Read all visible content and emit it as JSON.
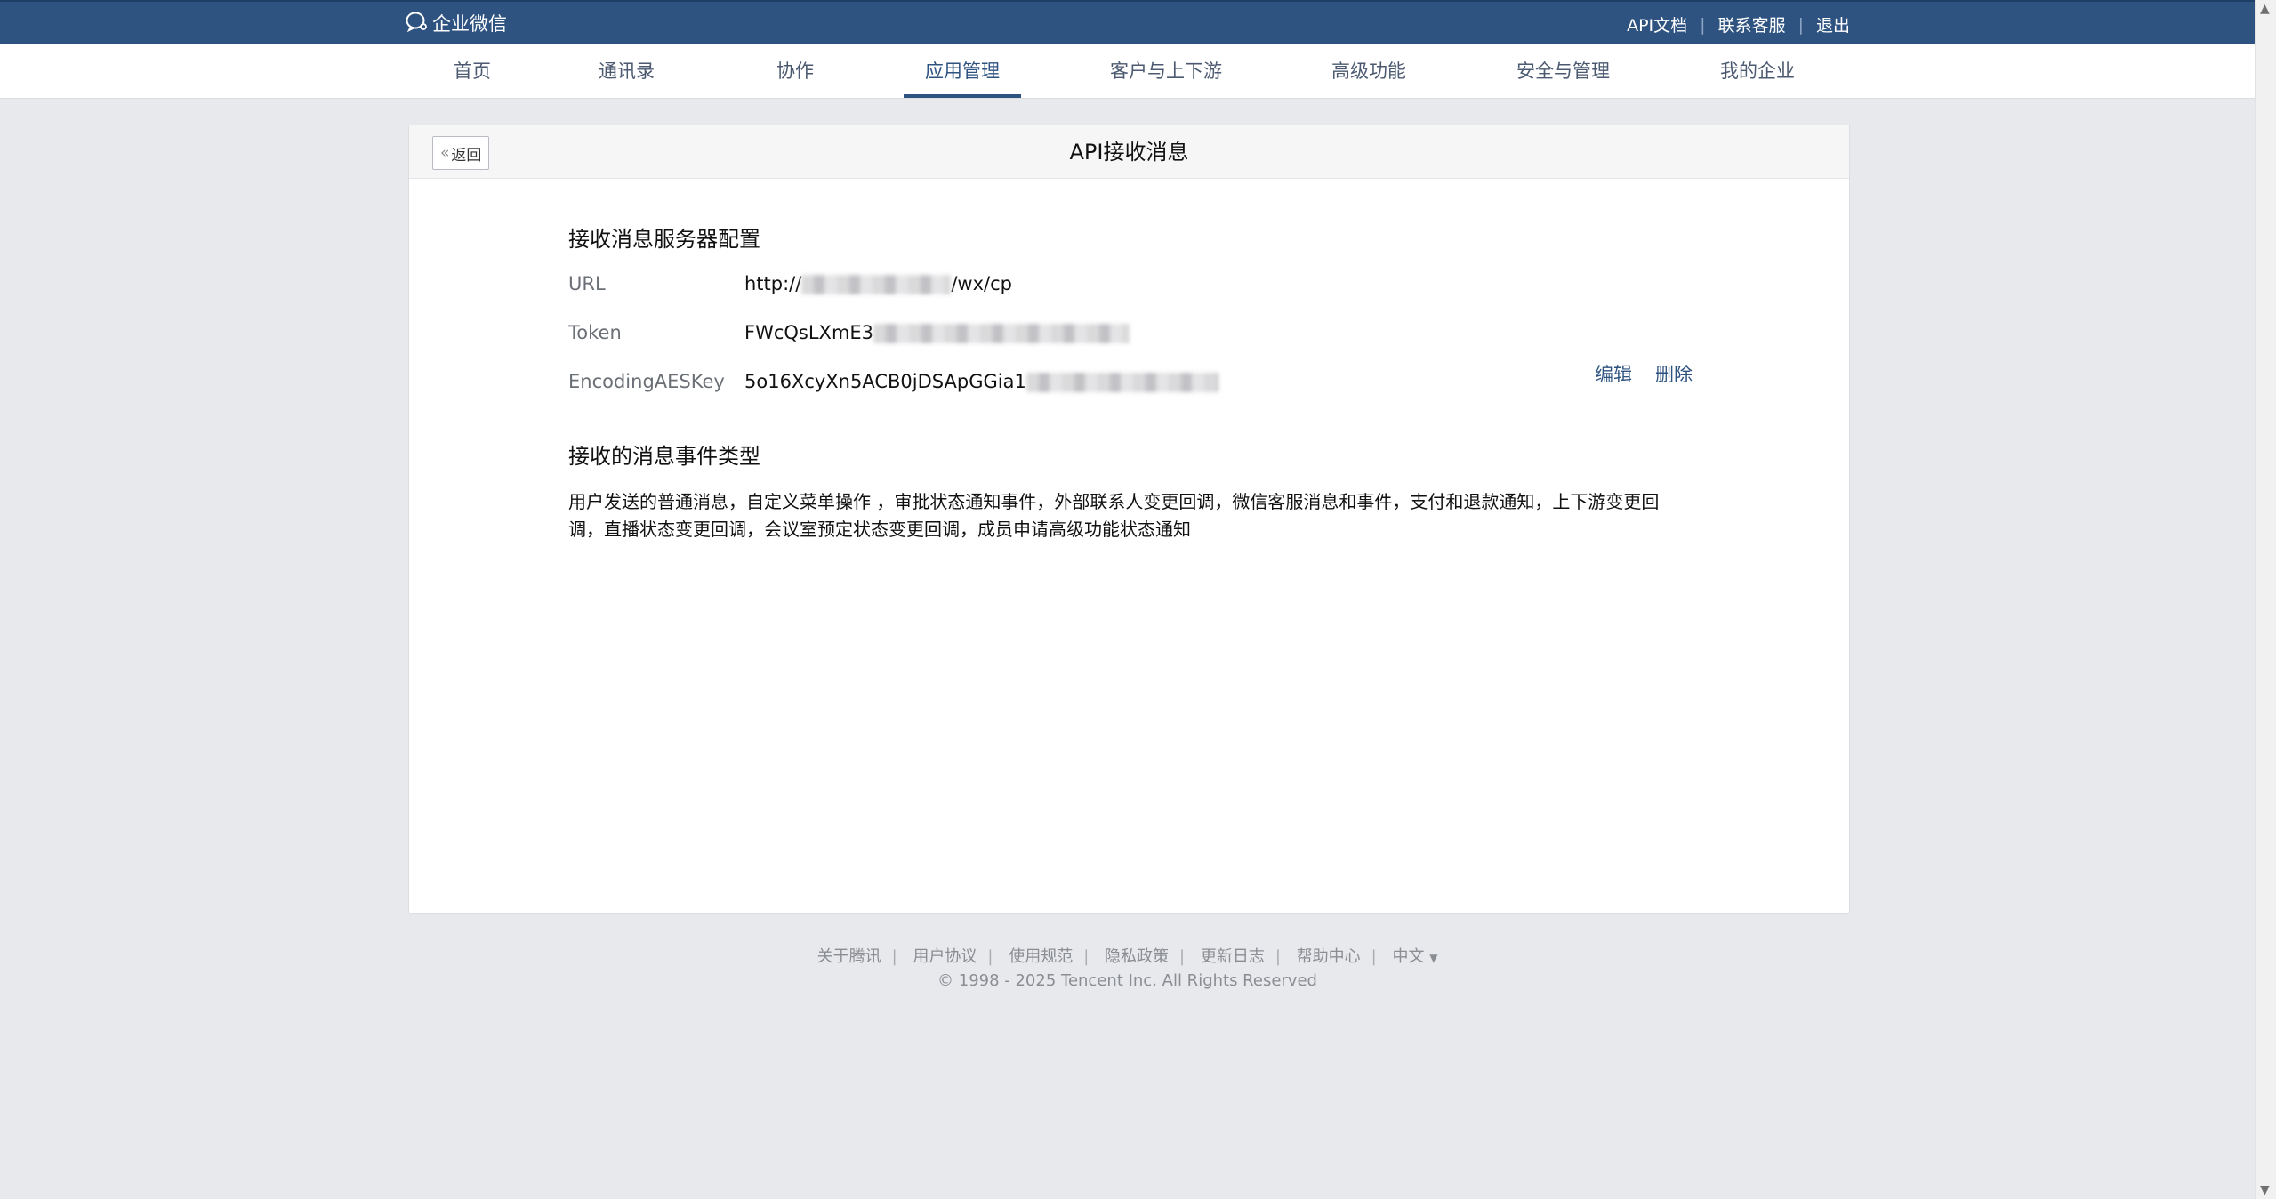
{
  "header": {
    "brand": "企业微信",
    "links": [
      "API文档",
      "联系客服",
      "退出"
    ]
  },
  "nav": {
    "items": [
      "首页",
      "通讯录",
      "协作",
      "应用管理",
      "客户与上下游",
      "高级功能",
      "安全与管理",
      "我的企业"
    ],
    "active": "应用管理"
  },
  "page": {
    "back_label": "返回",
    "title": "API接收消息"
  },
  "config": {
    "section_title": "接收消息服务器配置",
    "url_label": "URL",
    "url_prefix": "http://",
    "url_suffix": "/wx/cp",
    "token_label": "Token",
    "token_prefix": "FWcQsLXmE3",
    "aeskey_label": "EncodingAESKey",
    "aeskey_prefix": "5o16XcyXn5ACB0jDSApGGia1",
    "edit_label": "编辑",
    "delete_label": "删除"
  },
  "events": {
    "section_title": "接收的消息事件类型",
    "description": "用户发送的普通消息，自定义菜单操作 ，审批状态通知事件，外部联系人变更回调，微信客服消息和事件，支付和退款通知，上下游变更回调，直播状态变更回调，会议室预定状态变更回调，成员申请高级功能状态通知"
  },
  "footer": {
    "links": [
      "关于腾讯",
      "用户协议",
      "使用规范",
      "隐私政策",
      "更新日志",
      "帮助中心",
      "中文"
    ],
    "lang_caret": "▼",
    "copyright": "© 1998 - 2025 Tencent Inc. All Rights Reserved"
  },
  "colors": {
    "topbar": "#2e5381",
    "accent": "#2e5381",
    "background": "#e8e9ec"
  },
  "icons": {
    "brand": "wecom-logo-icon",
    "back": "double-chevron-left-icon",
    "scroll_up": "arrow-up-icon",
    "scroll_down": "arrow-down-icon"
  }
}
